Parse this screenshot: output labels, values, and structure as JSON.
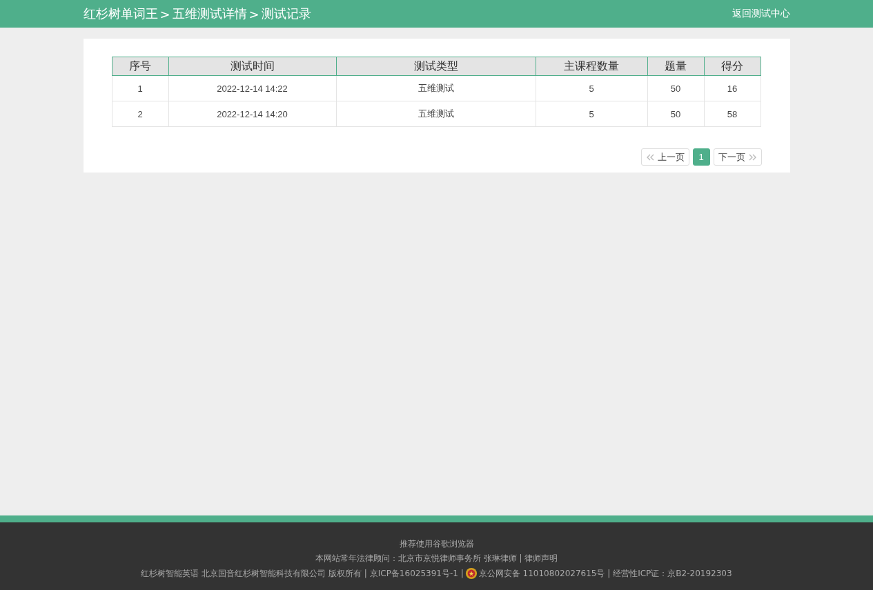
{
  "header": {
    "breadcrumb": [
      "红杉树单词王",
      "五维测试详情",
      "测试记录"
    ],
    "separator": ">",
    "back_link": "返回测试中心"
  },
  "table": {
    "columns": [
      "序号",
      "测试时间",
      "测试类型",
      "主课程数量",
      "题量",
      "得分"
    ],
    "rows": [
      [
        "1",
        "2022-12-14 14:22",
        "五维测试",
        "5",
        "50",
        "16"
      ],
      [
        "2",
        "2022-12-14 14:20",
        "五维测试",
        "5",
        "50",
        "58"
      ]
    ]
  },
  "pagination": {
    "prev": "上一页",
    "next": "下一页",
    "pages": [
      {
        "label": "1",
        "selected": true
      }
    ]
  },
  "footer": {
    "browser_note": "推荐使用谷歌浏览器",
    "legal": "本网站常年法律顾问：北京市京悦律师事务所 张琳律师 | 律师声明",
    "copyright": "红杉树智能英语 北京国音红杉树智能科技有限公司 版权所有 | 京ICP备16025391号-1 |",
    "police": "京公网安备 11010802027615号  | 经营性ICP证：京B2-20192303"
  }
}
